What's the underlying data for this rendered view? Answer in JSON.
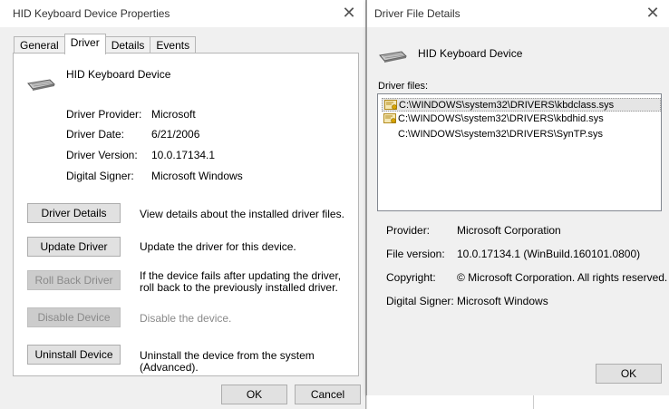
{
  "props": {
    "title": "HID Keyboard Device Properties",
    "tabs": [
      "General",
      "Driver",
      "Details",
      "Events"
    ],
    "device_name": "HID Keyboard Device",
    "info": [
      {
        "label": "Driver Provider:",
        "value": "Microsoft"
      },
      {
        "label": "Driver Date:",
        "value": "6/21/2006"
      },
      {
        "label": "Driver Version:",
        "value": "10.0.17134.1"
      },
      {
        "label": "Digital Signer:",
        "value": "Microsoft Windows"
      }
    ],
    "actions": [
      {
        "label": "Driver Details",
        "desc": "View details about the installed driver files.",
        "enabled": true
      },
      {
        "label": "Update Driver",
        "desc": "Update the driver for this device.",
        "enabled": true
      },
      {
        "label": "Roll Back Driver",
        "desc": "If the device fails after updating the driver, roll back to the previously installed driver.",
        "enabled": false
      },
      {
        "label": "Disable Device",
        "desc": "Disable the device.",
        "enabled": false
      },
      {
        "label": "Uninstall Device",
        "desc": "Uninstall the device from the system (Advanced).",
        "enabled": true
      }
    ],
    "ok": "OK",
    "cancel": "Cancel"
  },
  "details": {
    "title": "Driver File Details",
    "device_name": "HID Keyboard Device",
    "files_label": "Driver files:",
    "files": [
      {
        "path": "C:\\WINDOWS\\system32\\DRIVERS\\kbdclass.sys",
        "signed_icon": true,
        "selected": true
      },
      {
        "path": "C:\\WINDOWS\\system32\\DRIVERS\\kbdhid.sys",
        "signed_icon": true,
        "selected": false
      },
      {
        "path": "C:\\WINDOWS\\system32\\DRIVERS\\SynTP.sys",
        "signed_icon": false,
        "selected": false
      }
    ],
    "properties": [
      {
        "label": "Provider:",
        "value": "Microsoft Corporation"
      },
      {
        "label": "File version:",
        "value": "10.0.17134.1 (WinBuild.160101.0800)"
      },
      {
        "label": "Copyright:",
        "value": "© Microsoft Corporation. All rights reserved."
      },
      {
        "label": "Digital Signer:",
        "value": "Microsoft Windows"
      }
    ],
    "ok": "OK"
  },
  "icons": {
    "close": "close-icon",
    "keyboard": "keyboard-icon",
    "file": "certificate-file-icon"
  }
}
